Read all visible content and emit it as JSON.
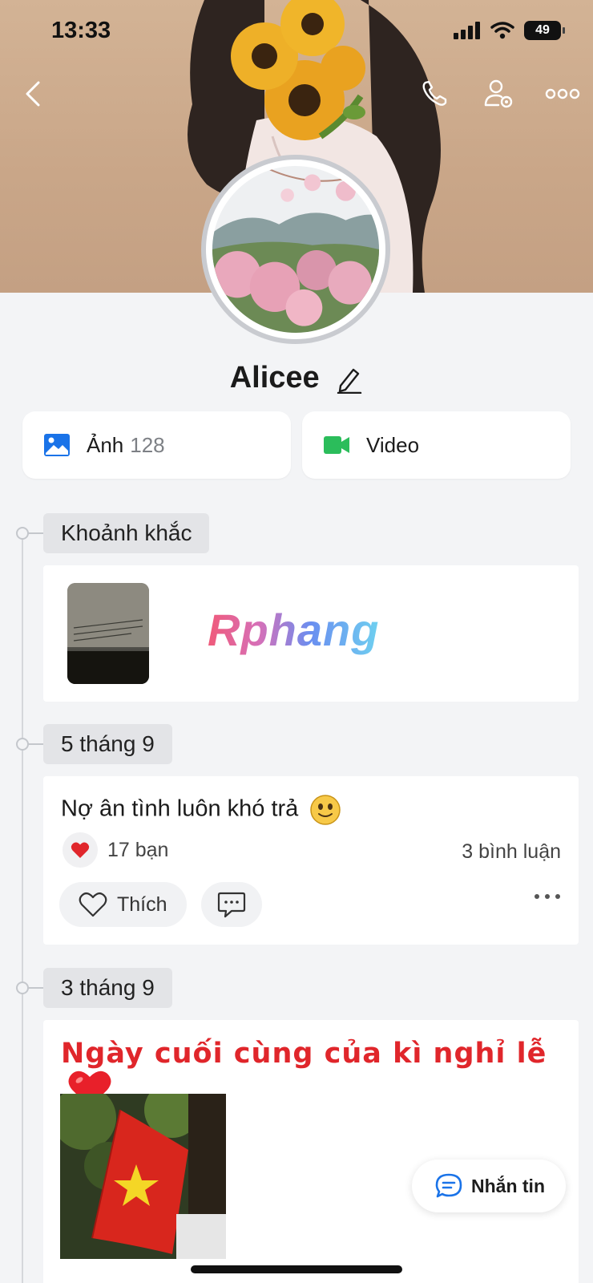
{
  "status": {
    "time": "13:33",
    "battery": "49"
  },
  "profile": {
    "name": "Alicee"
  },
  "media": {
    "photos_label": "Ảnh",
    "photos_count": "128",
    "video_label": "Video"
  },
  "timeline": {
    "moments_label": "Khoảnh khắc",
    "watermark": "Rphang",
    "date1": "5 tháng 9",
    "post1": {
      "text": "Nợ ân tình luôn khó trả",
      "reactions": "17 bạn",
      "comments": "3 bình luận",
      "like_label": "Thích"
    },
    "date2": "3 tháng 9",
    "post2": {
      "title": "Ngày cuối cùng của kì nghỉ lễ"
    }
  },
  "message_button": "Nhắn tin",
  "colors": {
    "accent_blue": "#1a73e8",
    "video_green": "#2bbd5b",
    "heart_red": "#e0262b"
  }
}
